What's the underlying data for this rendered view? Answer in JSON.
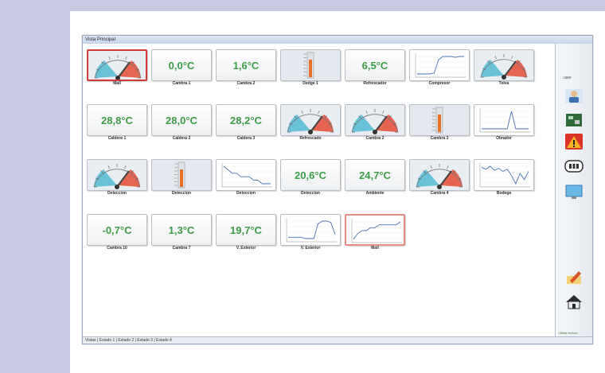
{
  "window": {
    "title": "Vista Principal"
  },
  "tiles": [
    {
      "label": "Mall",
      "type": "gauge",
      "alarm": "strong",
      "pink": true
    },
    {
      "label": "Cambra 1",
      "type": "value",
      "value": "0,0°C"
    },
    {
      "label": "Cambra 2",
      "type": "value",
      "value": "1,6°C"
    },
    {
      "label": "Dedge 1",
      "type": "thermo"
    },
    {
      "label": "Refrescador",
      "type": "value",
      "value": "6,5°C"
    },
    {
      "label": "Compresor",
      "type": "trend",
      "trend": [
        6,
        6,
        6,
        6,
        7,
        22,
        26,
        26,
        26,
        25,
        26,
        26
      ]
    },
    {
      "label": "Tolva",
      "type": "gauge"
    },
    {
      "label": "Caldera 1",
      "type": "value",
      "value": "28,8°C"
    },
    {
      "label": "Caldera 2",
      "type": "value",
      "value": "28,0°C"
    },
    {
      "label": "Caldera 3",
      "type": "value",
      "value": "28,2°C"
    },
    {
      "label": "Refrescado",
      "type": "gauge"
    },
    {
      "label": "Cambra 2",
      "type": "gauge"
    },
    {
      "label": "Cambra 3",
      "type": "thermo"
    },
    {
      "label": "Obrador",
      "type": "trend",
      "trend": [
        10,
        10,
        10,
        10,
        10,
        10,
        10,
        11,
        10,
        10,
        10,
        10
      ]
    },
    {
      "label": "Deteccion",
      "type": "gauge"
    },
    {
      "label": "Deteccion",
      "type": "thermo"
    },
    {
      "label": "Deteccion",
      "type": "trend",
      "trend": [
        20,
        19,
        18,
        18,
        17,
        17,
        17,
        16,
        16,
        15,
        15,
        15
      ]
    },
    {
      "label": "Deteccion",
      "type": "value",
      "value": "20,6°C"
    },
    {
      "label": "Ambiente",
      "type": "value",
      "value": "24,7°C"
    },
    {
      "label": "Cambra 4",
      "type": "gauge"
    },
    {
      "label": "Bodega",
      "type": "trend",
      "trend": [
        26,
        24,
        27,
        23,
        25,
        22,
        24,
        18,
        10,
        20,
        14,
        22
      ]
    },
    {
      "label": "Cambra 10",
      "type": "value",
      "value": "-0,7°C"
    },
    {
      "label": "Cambra 7",
      "type": "value",
      "value": "1,3°C"
    },
    {
      "label": "V. Exterior",
      "type": "value",
      "value": "19,7°C"
    },
    {
      "label": "V. Exterior",
      "type": "trend",
      "trend": [
        12,
        12,
        12,
        12,
        11,
        11,
        11,
        22,
        24,
        24,
        23,
        14
      ]
    },
    {
      "label": "Mall",
      "type": "trend",
      "trend": [
        10,
        12,
        13,
        13,
        14,
        14,
        15,
        15,
        15,
        15,
        15,
        16
      ],
      "alarm": "light"
    }
  ],
  "sidebar": {
    "top_label": "user",
    "buttons": [
      {
        "name": "user-icon"
      },
      {
        "name": "circuit-board-icon"
      },
      {
        "name": "warning-icon"
      },
      {
        "name": "battery-icon"
      },
      {
        "name": "monitor-icon"
      },
      {
        "name": "edit-icon"
      },
      {
        "name": "home-icon"
      }
    ],
    "bottom_label": "Ultima lectura"
  },
  "statusbar": {
    "text": "Vistas | Estado 1 | Estado 2 | Estado 3 | Estado 4"
  },
  "colors": {
    "value_green": "#3c9c45",
    "alarm_red": "#d23a3a",
    "gauge_red": "#e4553f",
    "gauge_blue": "#5bbcd4"
  }
}
